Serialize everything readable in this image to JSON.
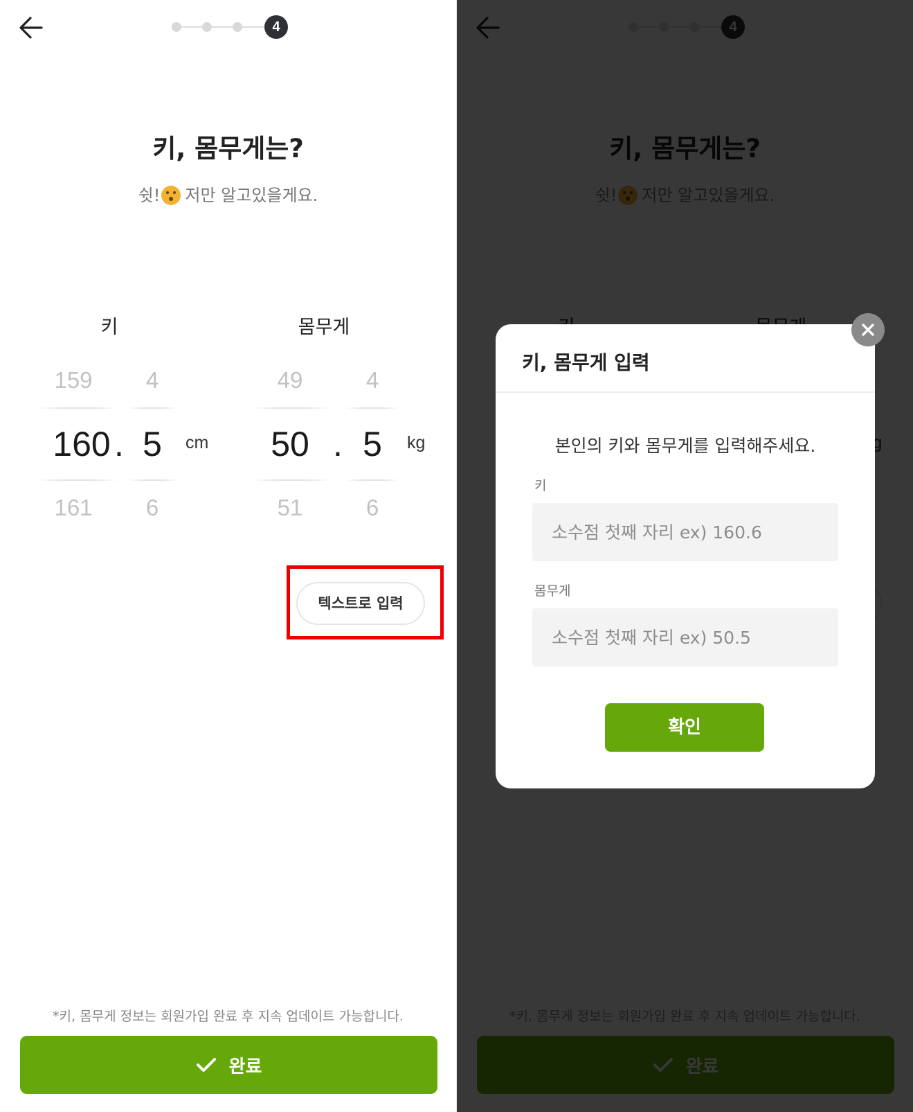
{
  "header": {
    "current_step": "4"
  },
  "page": {
    "title": "키, 몸무게는?",
    "subtitle_prefix": "쉿!",
    "subtitle_suffix": "저만 알고있을게요."
  },
  "picker": {
    "height": {
      "label": "키",
      "int_above": "159",
      "int_selected": "160",
      "int_below": "161",
      "dot": ".",
      "dec_above": "4",
      "dec_selected": "5",
      "dec_below": "6",
      "unit": "cm"
    },
    "weight": {
      "label": "몸무게",
      "int_above": "49",
      "int_selected": "50",
      "int_below": "51",
      "dot": ".",
      "dec_above": "4",
      "dec_selected": "5",
      "dec_below": "6",
      "unit": "kg"
    }
  },
  "text_input_button": "텍스트로 입력",
  "notice": "*키, 몸무게 정보는 회원가입 완료 후 지속 업데이트 가능합니다.",
  "complete_button": "완료",
  "modal": {
    "title": "키, 몸무게 입력",
    "instruction": "본인의 키와 몸무게를 입력해주세요.",
    "height_label": "키",
    "height_placeholder": "소수점 첫째 자리 ex) 160.6",
    "weight_label": "몸무게",
    "weight_placeholder": "소수점 첫째 자리 ex) 50.5",
    "confirm_button": "확인"
  },
  "colors": {
    "accent_green": "#66a80a",
    "highlight_red": "#ee0000",
    "step_active": "#2e3035",
    "overlay": "rgba(0,0,0,0.78)"
  },
  "icons": {
    "back": "arrow-left-icon",
    "check": "check-icon",
    "close": "close-icon",
    "emoji": "hushed-face-emoji"
  }
}
